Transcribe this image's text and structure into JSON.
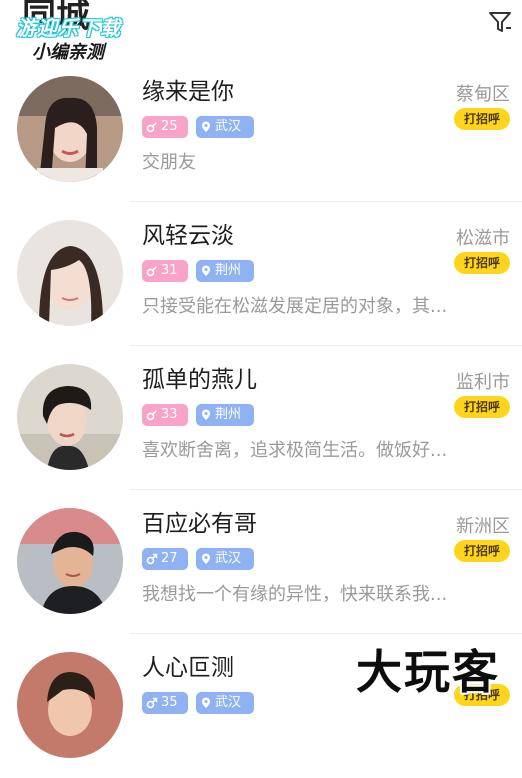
{
  "header": {
    "title": "同城",
    "filter_icon": "filter-icon"
  },
  "watermark_top": {
    "line1": "游迎乐下载",
    "line2": "小编亲测"
  },
  "watermark_bottom": "大玩客",
  "users": [
    {
      "name": "缘来是你",
      "district": "蔡甸区",
      "age": "25",
      "gender": "female",
      "city": "武汉",
      "bio": "交朋友",
      "greet_label": "打招呼"
    },
    {
      "name": "风轻云淡",
      "district": "松滋市",
      "age": "31",
      "gender": "female",
      "city": "荆州",
      "bio": "只接受能在松滋发展定居的对象，其...",
      "greet_label": "打招呼"
    },
    {
      "name": "孤单的燕儿",
      "district": "监利市",
      "age": "33",
      "gender": "female",
      "city": "荆州",
      "bio": "喜欢断舍离，追求极简生活。做饭好...",
      "greet_label": "打招呼"
    },
    {
      "name": "百应必有哥",
      "district": "新洲区",
      "age": "27",
      "gender": "male",
      "city": "武汉",
      "bio": "我想找一个有缘的异性，快来联系我...",
      "greet_label": "打招呼"
    },
    {
      "name": "人心叵测",
      "district": "",
      "age": "35",
      "gender": "male",
      "city": "武汉",
      "bio": "",
      "greet_label": "打招呼"
    }
  ],
  "colors": {
    "accent": "#ffd41c",
    "female_badge": "#f9a3c8",
    "male_badge": "#8fb3f2",
    "city_badge": "#8fb3f2"
  }
}
